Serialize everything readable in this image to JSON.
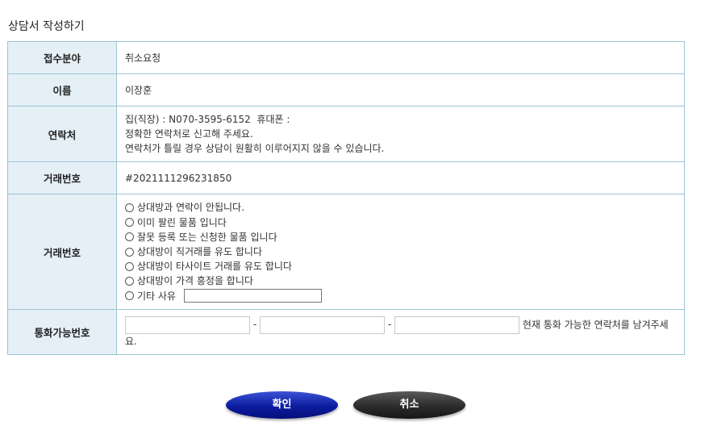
{
  "page_title": "상담서 작성하기",
  "fields": {
    "category": {
      "label": "접수분야",
      "value": "취소요청"
    },
    "name": {
      "label": "이름",
      "value": "이장훈"
    },
    "contact": {
      "label": "연락처",
      "line1": "집(직장) : N070-3595-6152  휴대폰 :",
      "line2": "정확한 연락처로 신고해 주세요.",
      "line3": "연락처가 틀릴 경우 상담이 원활히 이루어지지 않을 수 있습니다."
    },
    "deal_number": {
      "label": "거래번호",
      "value": "#2021111296231850"
    },
    "reasons": {
      "label": "거래번호",
      "options": [
        "상대방과 연락이 안됩니다.",
        "이미 팔린 물품 입니다",
        "잘못 등록 또는 신청한 물품 입니다",
        "상대방이 직거래를 유도 합니다",
        "상대방이 타사이트 거래를 유도 합니다",
        "상대방이 가격 흥정을 합니다",
        "기타 사유"
      ],
      "etc_value": ""
    },
    "phone": {
      "label": "통화가능번호",
      "part1": "",
      "part2": "",
      "part3": "",
      "separator": "-",
      "hint": "현재 통화 가능한 연락처를 남겨주세요."
    }
  },
  "buttons": {
    "confirm": "확인",
    "cancel": "취소"
  },
  "colors": {
    "border": "#9bc5d5",
    "header_bg": "#e4f0f6",
    "confirm_btn": "#0b1c9e",
    "cancel_btn": "#2b2b2b"
  }
}
